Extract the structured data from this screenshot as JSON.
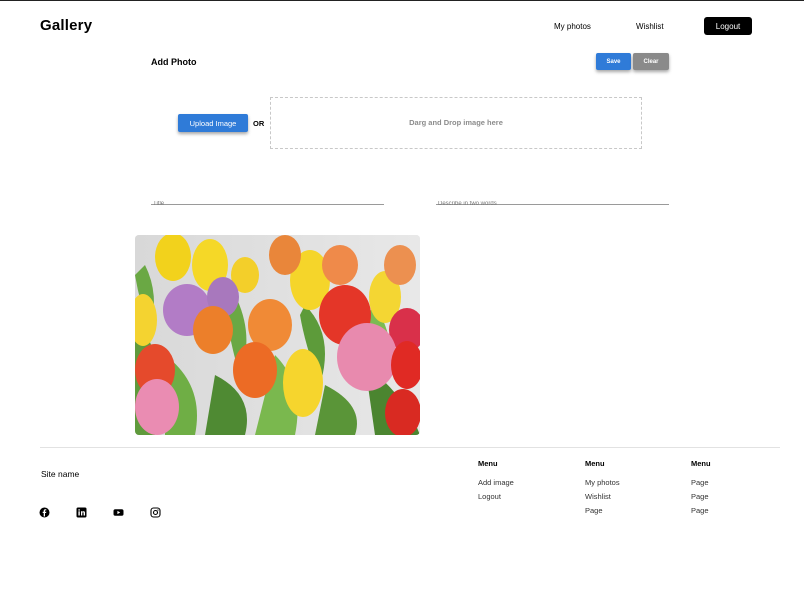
{
  "header": {
    "brand": "Gallery",
    "nav": {
      "my_photos": "My photos",
      "wishlist": "Wishlist",
      "logout": "Logout"
    }
  },
  "form": {
    "title": "Add Photo",
    "save_label": "Save",
    "clear_label": "Clear",
    "upload_label": "Upload Image",
    "or_label": "OR",
    "dropzone_text": "Darg and Drop image here",
    "title_placeholder": "Title",
    "description_placeholder": "Describe in two words"
  },
  "preview": {
    "subject": "tulips photo"
  },
  "footer": {
    "site_name": "Site name",
    "social": [
      "facebook-icon",
      "linkedin-icon",
      "youtube-icon",
      "instagram-icon"
    ],
    "menus": [
      {
        "heading": "Menu",
        "links": [
          "Add image",
          "Logout"
        ]
      },
      {
        "heading": "Menu",
        "links": [
          "My photos",
          "Wishlist",
          "Page"
        ]
      },
      {
        "heading": "Menu",
        "links": [
          "Page",
          "Page",
          "Page"
        ]
      }
    ]
  },
  "colors": {
    "primary": "#2f7bd8",
    "secondary": "#8a8a8a",
    "dark": "#000000"
  }
}
